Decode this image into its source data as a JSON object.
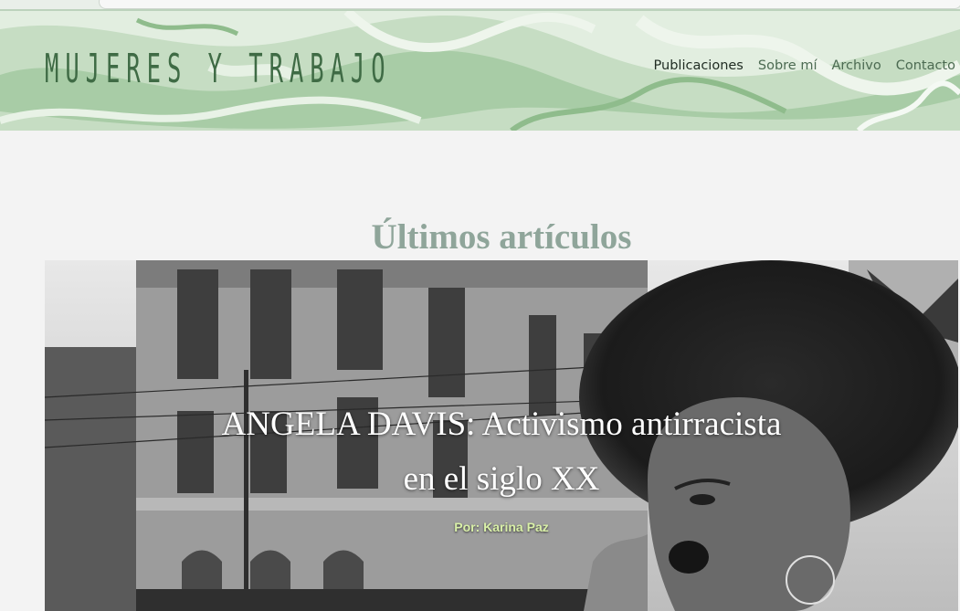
{
  "site": {
    "brand": "MUJERES Y TRABAJO",
    "nav": [
      {
        "label": "Publicaciones",
        "active": true
      },
      {
        "label": "Sobre mí",
        "active": false
      },
      {
        "label": "Archivo",
        "active": false
      },
      {
        "label": "Contacto",
        "active": false
      }
    ]
  },
  "main": {
    "section_title": "Últimos artículos",
    "featured": {
      "title_line1": "ANGELA DAVIS: Activismo antirracista",
      "title_line2": "en el siglo XX",
      "author": "Por: Karina Paz"
    }
  },
  "colors": {
    "header_green": "#c7dec5",
    "brand_green": "#3f6b45",
    "title_grey_green": "#8fa59a",
    "author_lime": "#d9f0a8"
  }
}
